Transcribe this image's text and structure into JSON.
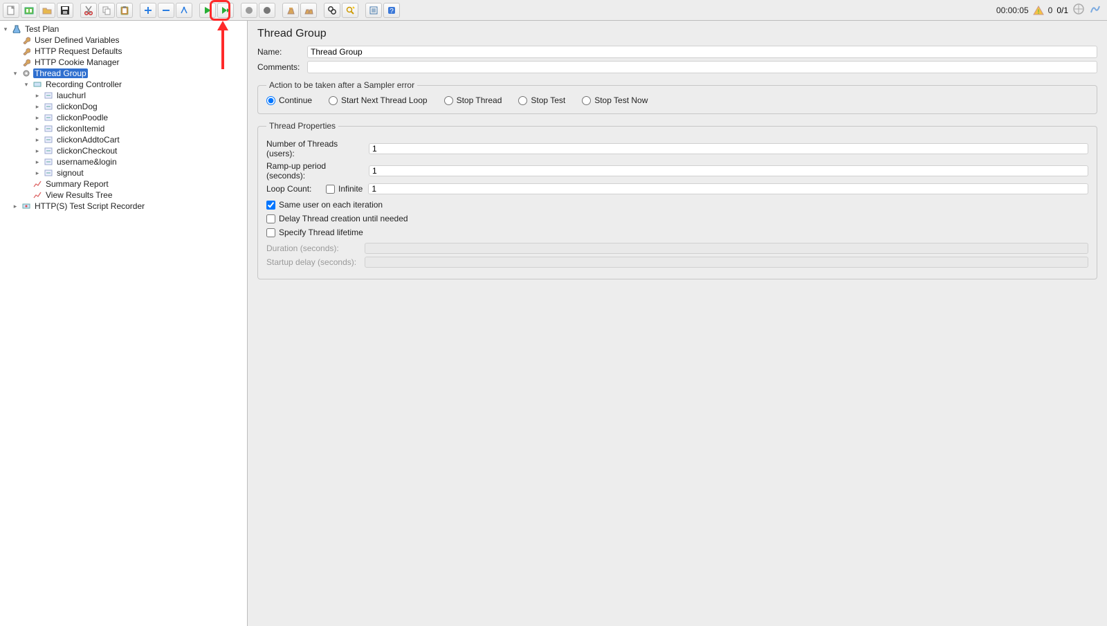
{
  "toolbar": {
    "buttons": [
      "new-file",
      "templates",
      "open",
      "save",
      "cut",
      "copy",
      "paste",
      "expand",
      "collapse",
      "toggle",
      "start",
      "start-no-pause",
      "stop",
      "shutdown",
      "clear-one",
      "clear-all",
      "search",
      "function-helper",
      "options",
      "help"
    ],
    "time": "00:00:05",
    "warn_count": "0",
    "thread_ratio": "0/1"
  },
  "tree": {
    "root": {
      "label": "Test Plan",
      "icon": "flask",
      "expanded": true
    },
    "children": [
      {
        "label": "User Defined Variables",
        "icon": "wrench"
      },
      {
        "label": "HTTP Request Defaults",
        "icon": "wrench"
      },
      {
        "label": "HTTP Cookie Manager",
        "icon": "wrench"
      },
      {
        "label": "Thread Group",
        "icon": "gear",
        "selected": true,
        "expanded": true,
        "children": [
          {
            "label": "Recording Controller",
            "icon": "controller",
            "expanded": true,
            "children": [
              {
                "label": "lauchurl",
                "icon": "sampler"
              },
              {
                "label": "clickonDog",
                "icon": "sampler"
              },
              {
                "label": "clickonPoodle",
                "icon": "sampler"
              },
              {
                "label": "clickonItemid",
                "icon": "sampler"
              },
              {
                "label": "clickonAddtoCart",
                "icon": "sampler"
              },
              {
                "label": "clickonCheckout",
                "icon": "sampler"
              },
              {
                "label": "username&login",
                "icon": "sampler"
              },
              {
                "label": "signout",
                "icon": "sampler"
              }
            ]
          },
          {
            "label": "Summary Report",
            "icon": "chart"
          },
          {
            "label": "View Results Tree",
            "icon": "chart"
          }
        ]
      },
      {
        "label": "HTTP(S) Test Script Recorder",
        "icon": "recorder"
      }
    ]
  },
  "editor": {
    "title": "Thread Group",
    "name_label": "Name:",
    "name_value": "Thread Group",
    "comments_label": "Comments:",
    "comments_value": "",
    "sampler_error": {
      "legend": "Action to be taken after a Sampler error",
      "options": [
        "Continue",
        "Start Next Thread Loop",
        "Stop Thread",
        "Stop Test",
        "Stop Test Now"
      ],
      "selected": "Continue"
    },
    "thread_props": {
      "legend": "Thread Properties",
      "num_threads_label": "Number of Threads (users):",
      "num_threads": "1",
      "ramp_label": "Ramp-up period (seconds):",
      "ramp": "1",
      "loop_label": "Loop Count:",
      "infinite_label": "Infinite",
      "loop": "1",
      "same_user_label": "Same user on each iteration",
      "delay_label": "Delay Thread creation until needed",
      "specify_label": "Specify Thread lifetime",
      "duration_label": "Duration (seconds):",
      "startup_label": "Startup delay (seconds):"
    }
  }
}
